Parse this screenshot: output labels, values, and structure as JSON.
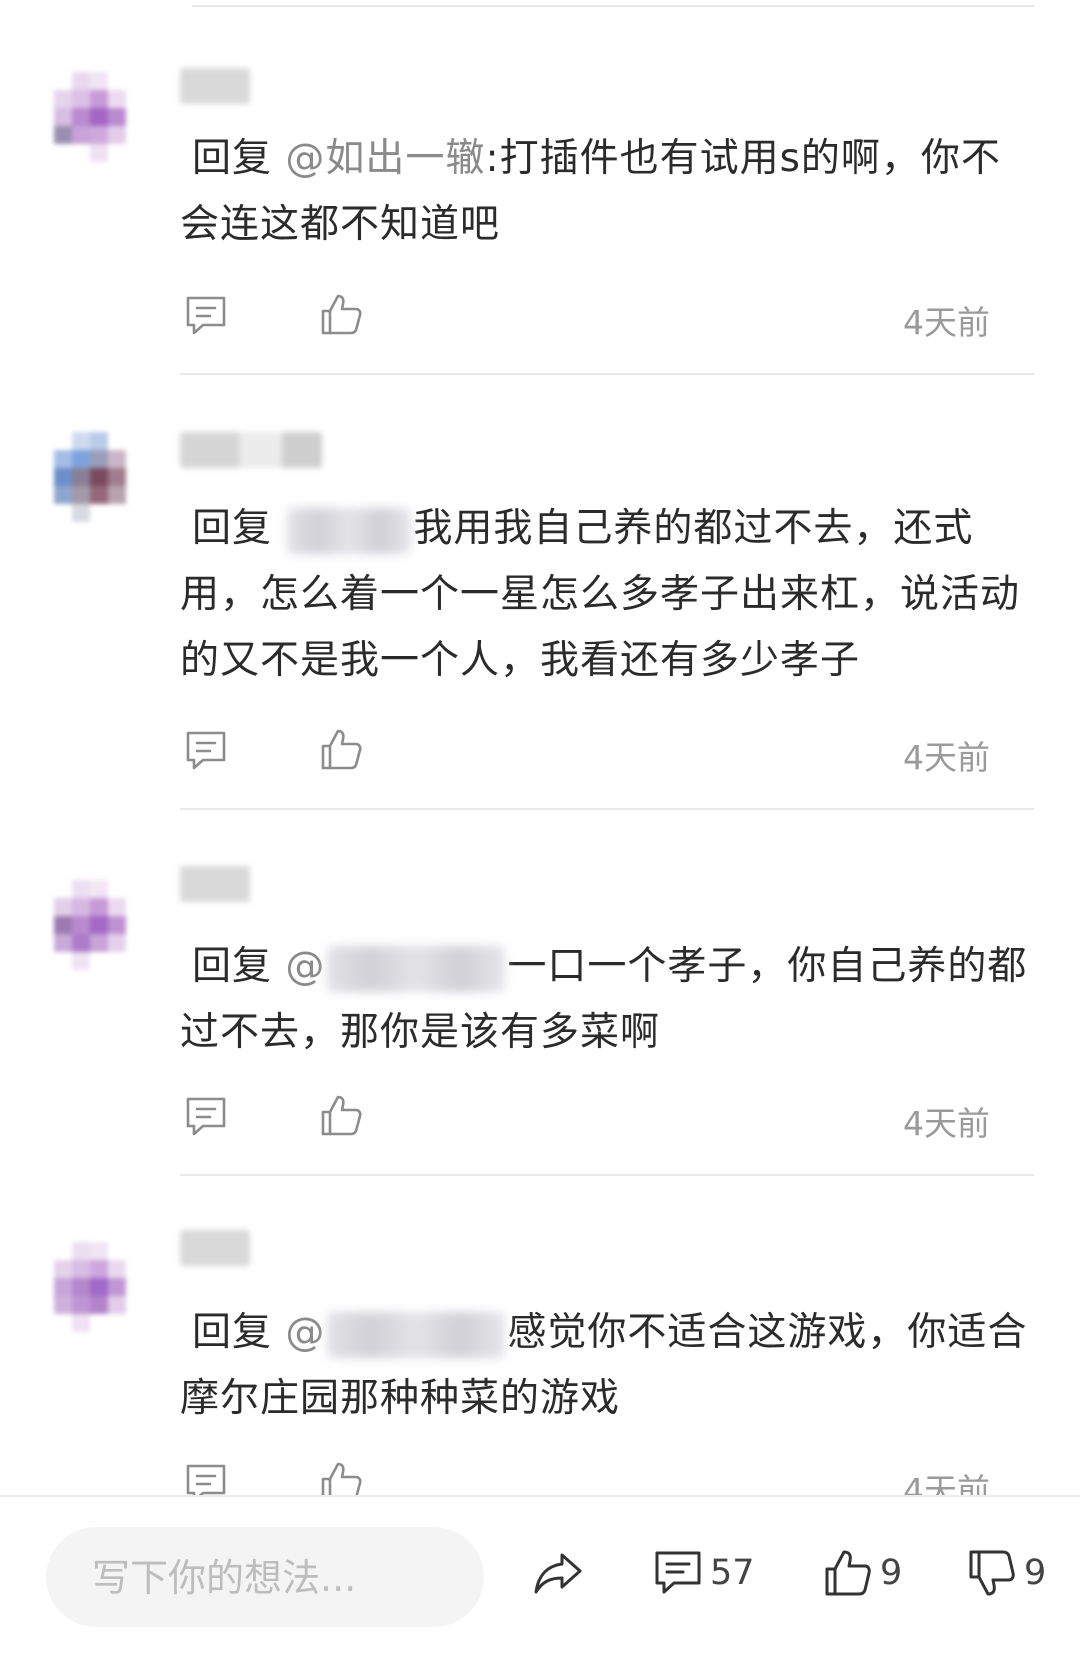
{
  "comments": [
    {
      "reply_prefix": "回复",
      "mention": "@如出一辙",
      "text": ":打插件也有试用s的啊，你不会连这都不知道吧",
      "time": "4天前"
    },
    {
      "reply_prefix": "回复",
      "text": "我用我自己养的都过不去，还式用，怎么着一个一星怎么多孝子出来杠，说活动的又不是我一个人，我看还有多少孝子",
      "time": "4天前"
    },
    {
      "reply_prefix": "回复",
      "mention_at": "@",
      "text": "一口一个孝子，你自己养的都过不去，那你是该有多菜啊",
      "time": "4天前"
    },
    {
      "reply_prefix": "回复",
      "mention_at": "@",
      "text": "感觉你不适合这游戏，你适合摩尔庄园那种种菜的游戏",
      "time": "4天前"
    }
  ],
  "icons": {
    "reply": "comment-bubble-icon",
    "like": "thumbs-up-icon",
    "share": "share-arrow-icon",
    "comments": "comment-bubble-icon",
    "dislike": "thumbs-down-icon"
  },
  "bottom_bar": {
    "placeholder": "写下你的想法...",
    "comment_count": "57",
    "like_count": "9",
    "dislike_count": "9"
  },
  "colors": {
    "text": "#2b2b2b",
    "muted": "#9a9a9a",
    "divider": "#e8e8e8",
    "avatar_purple": "#a06ac8"
  }
}
